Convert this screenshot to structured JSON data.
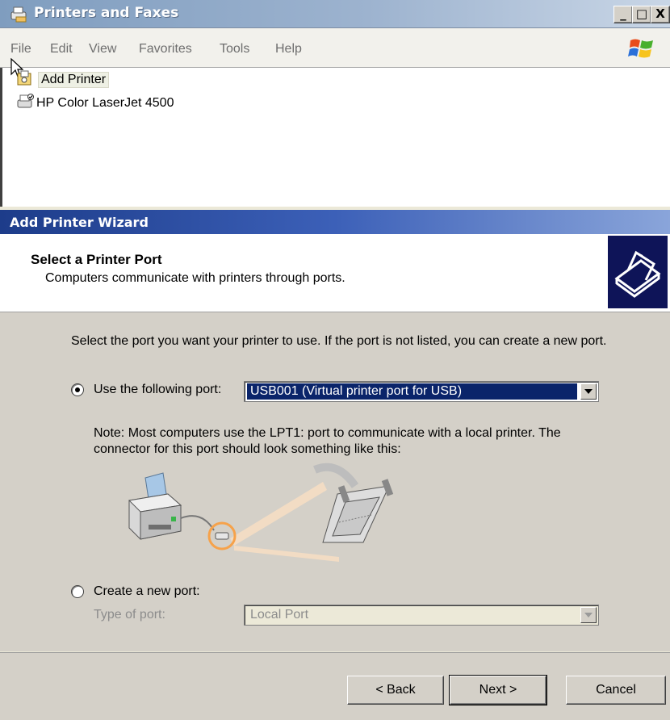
{
  "printers_window": {
    "title": "Printers and Faxes",
    "controls": {
      "minimize": "_",
      "maximize": "□",
      "close": "X"
    },
    "menu": [
      "File",
      "Edit",
      "View",
      "Favorites",
      "Tools",
      "Help"
    ],
    "items": [
      {
        "label": "Add Printer",
        "icon": "add-printer-icon"
      },
      {
        "label": "HP Color LaserJet 4500",
        "icon": "printer-icon"
      }
    ]
  },
  "wizard": {
    "title": "Add Printer Wizard",
    "header": {
      "title": "Select a Printer Port",
      "subtitle": "Computers communicate with printers through ports."
    },
    "instructions": "Select the port you want your printer to use.  If the port is not listed, you can create a new port.",
    "use_port": {
      "label": "Use the following port:",
      "value": "USB001 (Virtual printer port for USB)",
      "selected": true
    },
    "note": "Note: Most computers use the LPT1: port to communicate with a local printer. The connector for this port should look something like this:",
    "create_port": {
      "label": "Create a new port:",
      "type_label": "Type of port:",
      "type_value": "Local Port",
      "selected": false
    },
    "buttons": {
      "back": "< Back",
      "next": "Next >",
      "cancel": "Cancel"
    },
    "colors": {
      "title_bar": "#1d3c8a",
      "selection": "#0a246a",
      "highlight": "#f6a24a"
    }
  }
}
